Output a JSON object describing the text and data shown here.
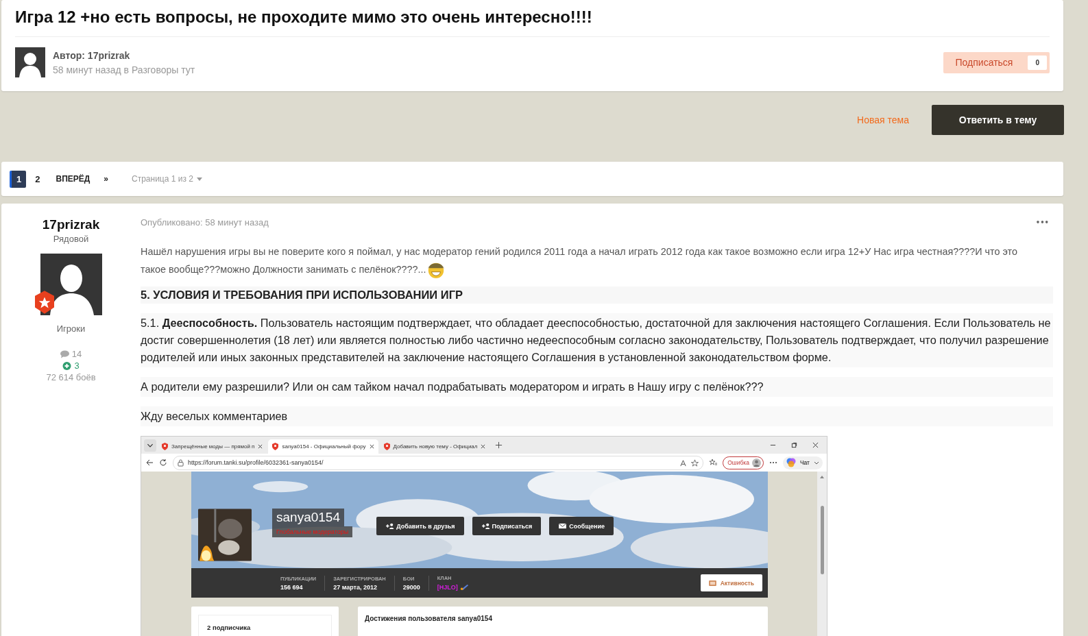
{
  "topic": {
    "title": "Игра 12 +но есть вопросы, не проходите мимо это очень интересно!!!!",
    "author_label": "Автор: 17prizrak",
    "meta": "58 минут назад в Разговоры тут",
    "follow": {
      "label": "Подписаться",
      "count": "0"
    }
  },
  "actions": {
    "new_topic": "Новая тема",
    "reply": "Ответить в тему"
  },
  "pagination": {
    "pages": [
      {
        "label": "1",
        "selected": true
      },
      {
        "label": "2",
        "selected": false
      }
    ],
    "next": "ВПЕРЁД",
    "last": "»",
    "page_info": "Страница 1 из 2"
  },
  "post": {
    "author": {
      "name": "17prizrak",
      "rank": "Рядовой",
      "group": "Игроки",
      "posts": "14",
      "reputation": "3",
      "battles": "72 614 боёв"
    },
    "published": "Опубликовано: 58 минут назад",
    "menu": "•••",
    "paragraphs": [
      {
        "kind": "intro",
        "lines": [
          "Нашёл нарушения игры вы не поверите кого я поймал, у нас модератор гений родился 2011 года а начал играть 2012 года как такое возможно если игра 12+У Нас игра честная????И что это",
          "такое вообще???можно Должности занимать с пелёнок????..."
        ]
      },
      {
        "kind": "heading",
        "text": "5. УСЛОВИЯ И ТРЕБОВАНИЯ ПРИ ИСПОЛЬЗОВАНИИ ИГР"
      },
      {
        "kind": "quote",
        "text": "5.1. **Дееспособность.** Пользователь настоящим подтверждает, что обладает дееспособностью, достаточной для заключения настоящего Соглашения. Если Пользователь не достиг совершеннолетия (18 лет) или является полностью либо частично недееспособным согласно законодательству, Пользователь подтверждает, что получил разрешение родителей или иных законных представителей на заключение настоящего Соглашения в установленной законодательством форме."
      },
      {
        "kind": "quote",
        "text": "А родители ему разрешили? Или он сам тайком начал подрабатывать модератором и играть в Нашу игру с пелёнок???"
      },
      {
        "kind": "quote",
        "text": "Жду веселых комментариев"
      }
    ],
    "screenshot": {
      "tabs": [
        {
          "title": "Запрещённые моды — прямой п",
          "selected": false
        },
        {
          "title": "sanya0154 - Официальный фору",
          "selected": true
        },
        {
          "title": "Добавить новую тему - Официал",
          "selected": false
        }
      ],
      "url": "https://forum.tanki.su/profile/6032361-sanya0154/",
      "error_label": "Ошибка",
      "chat_label": "Чат",
      "profile": {
        "name": "sanya0154",
        "group": "Глобальные модераторы",
        "buttons": [
          "Добавить в друзья",
          "Подписаться",
          "Сообщение"
        ],
        "stats": [
          {
            "label": "ПУБЛИКАЦИИ",
            "value": "156 694"
          },
          {
            "label": "ЗАРЕГИСТРИРОВАН",
            "value": "27 марта, 2012"
          },
          {
            "label": "БОИ",
            "value": "29000"
          },
          {
            "label": "КЛАН",
            "value": "[HJLO]"
          }
        ],
        "activity": "Активность",
        "followers": "2 подписчика",
        "achievements": "Достижения пользователя sanya0154"
      }
    }
  }
}
